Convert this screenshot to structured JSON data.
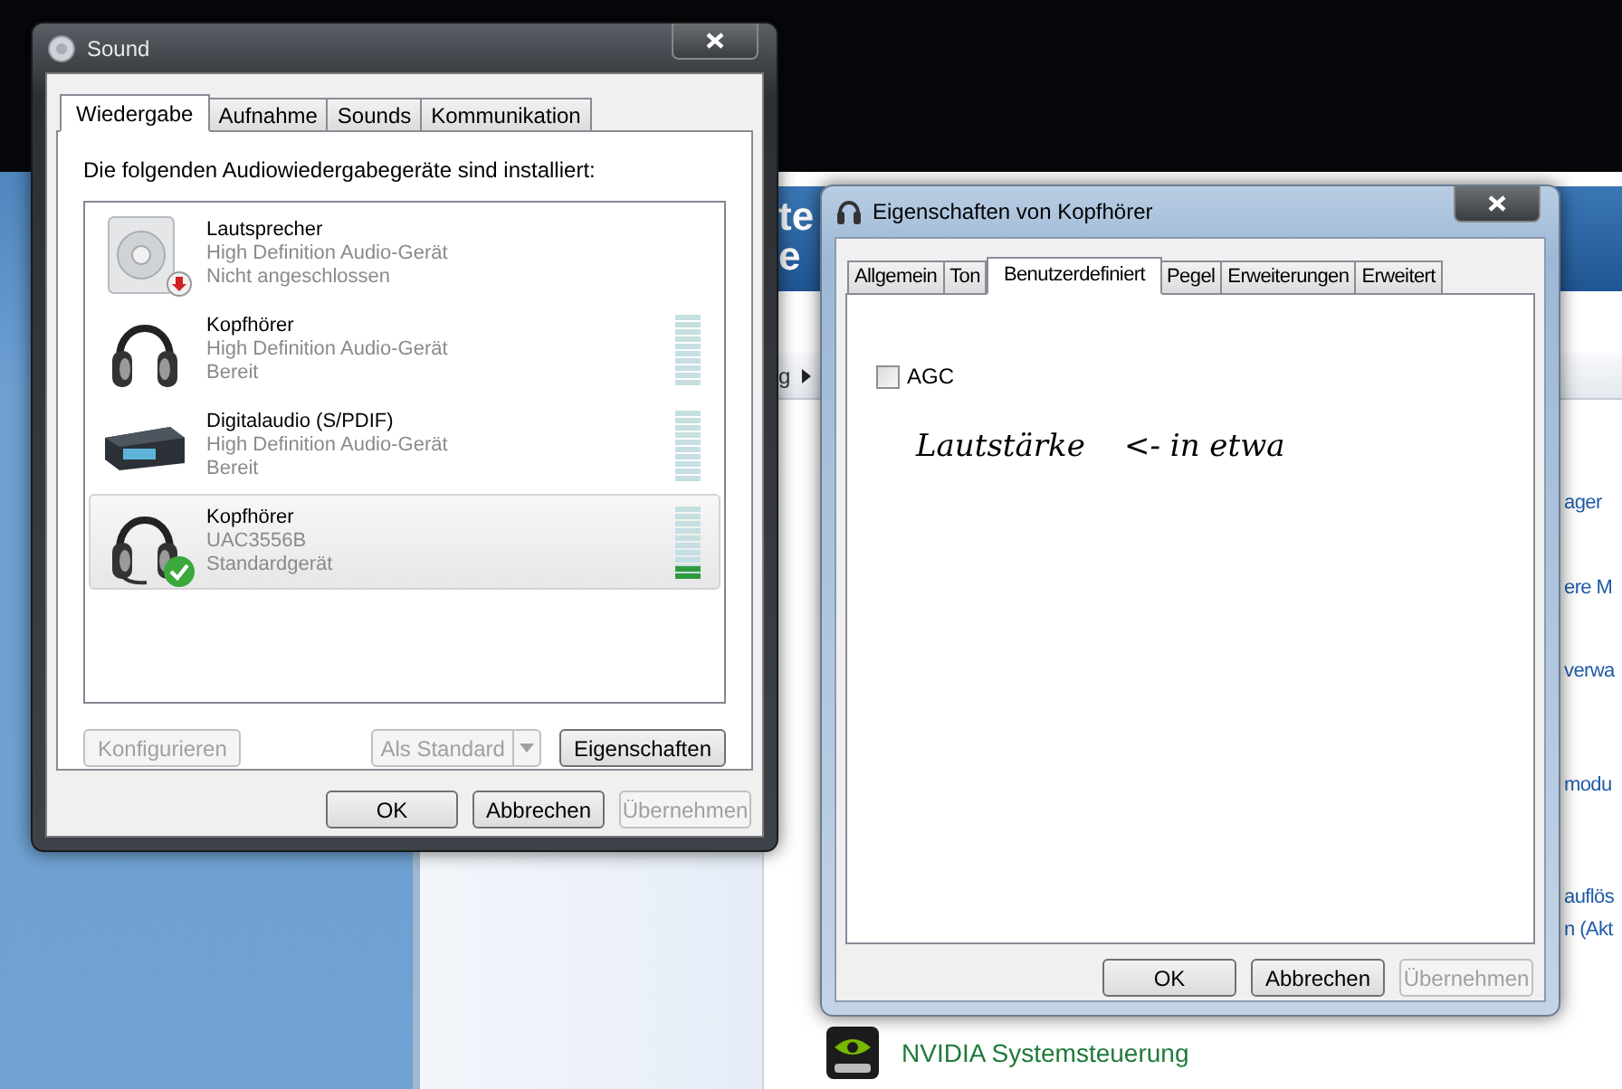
{
  "background_window": {
    "header_fragments": [
      "te",
      "e"
    ],
    "breadcrumb_fragment": "g",
    "links": [
      "ager",
      "ere M",
      "verwa",
      "modu",
      "auflös",
      "n (Akt"
    ],
    "nvidia_item": {
      "label": "NVIDIA Systemsteuerung"
    }
  },
  "sound_dialog": {
    "title": "Sound",
    "tabs": [
      {
        "label": "Wiedergabe",
        "selected": true
      },
      {
        "label": "Aufnahme",
        "selected": false
      },
      {
        "label": "Sounds",
        "selected": false
      },
      {
        "label": "Kommunikation",
        "selected": false
      }
    ],
    "description": "Die folgenden Audiowiedergabegeräte sind installiert:",
    "devices": [
      {
        "kind": "speaker",
        "unplugged": true,
        "default": false,
        "name": "Lautsprecher",
        "driver": "High Definition Audio-Gerät",
        "status": "Nicht angeschlossen",
        "selected": false
      },
      {
        "kind": "headphones",
        "unplugged": false,
        "default": false,
        "name": "Kopfhörer",
        "driver": "High Definition Audio-Gerät",
        "status": "Bereit",
        "selected": false,
        "level": 0
      },
      {
        "kind": "receiver",
        "unplugged": false,
        "default": false,
        "name": "Digitalaudio (S/PDIF)",
        "driver": "High Definition Audio-Gerät",
        "status": "Bereit",
        "selected": false,
        "level": 0
      },
      {
        "kind": "headset",
        "unplugged": false,
        "default": true,
        "name": "Kopfhörer",
        "driver": "UAC3556B",
        "status": "Standardgerät",
        "selected": true,
        "level": 0.2
      }
    ],
    "actions": [
      {
        "kind": "button",
        "label": "Konfigurieren",
        "disabled": true
      },
      {
        "kind": "split",
        "label": "Als Standard",
        "disabled": true
      },
      {
        "kind": "button",
        "label": "Eigenschaften",
        "disabled": false
      }
    ],
    "buttons": [
      {
        "label": "OK",
        "disabled": false
      },
      {
        "label": "Abbrechen",
        "disabled": false
      },
      {
        "label": "Übernehmen",
        "disabled": true
      }
    ]
  },
  "properties_dialog": {
    "title": "Eigenschaften von Kopfhörer",
    "tabs": [
      {
        "label": "Allgemein",
        "selected": false
      },
      {
        "label": "Ton",
        "selected": false
      },
      {
        "label": "Benutzerdefiniert",
        "selected": true
      },
      {
        "label": "Pegel",
        "selected": false
      },
      {
        "label": "Erweiterungen",
        "selected": false
      },
      {
        "label": "Erweitert",
        "selected": false
      }
    ],
    "agc": {
      "label": "AGC",
      "checked": false
    },
    "handwritten_note": "Lautstärke    <- in etwa",
    "buttons": [
      {
        "label": "OK",
        "disabled": false
      },
      {
        "label": "Abbrechen",
        "disabled": false
      },
      {
        "label": "Übernehmen",
        "disabled": true
      }
    ]
  }
}
